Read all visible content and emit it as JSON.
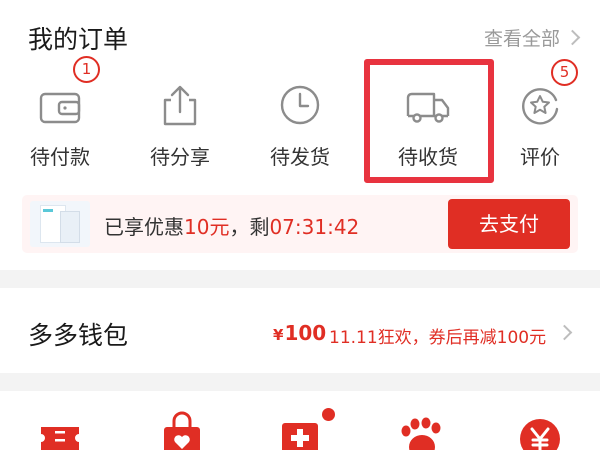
{
  "orders": {
    "title": "我的订单",
    "view_all": "查看全部",
    "items": [
      {
        "label": "待付款",
        "icon": "wallet-icon",
        "badge": "1"
      },
      {
        "label": "待分享",
        "icon": "share-icon",
        "badge": ""
      },
      {
        "label": "待发货",
        "icon": "clock-icon",
        "badge": ""
      },
      {
        "label": "待收货",
        "icon": "truck-icon",
        "badge": ""
      },
      {
        "label": "评价",
        "icon": "review-icon",
        "badge": "5"
      }
    ]
  },
  "promo": {
    "text_prefix": "已享优惠",
    "discount": "10元",
    "text_middle": "，剩",
    "countdown": "07:31:42",
    "pay_button": "去支付"
  },
  "wallet": {
    "title": "多多钱包",
    "currency": "¥",
    "amount": "100",
    "description": "11.11狂欢，券后再减100元"
  },
  "bottom_icons": [
    "ticket-icon",
    "shopping-bag-icon",
    "medical-icon",
    "footprint-icon",
    "yuan-coin-icon"
  ],
  "colors": {
    "accent": "#e02e24",
    "highlight": "#e8333f",
    "text_gray": "#9a9a9a"
  }
}
